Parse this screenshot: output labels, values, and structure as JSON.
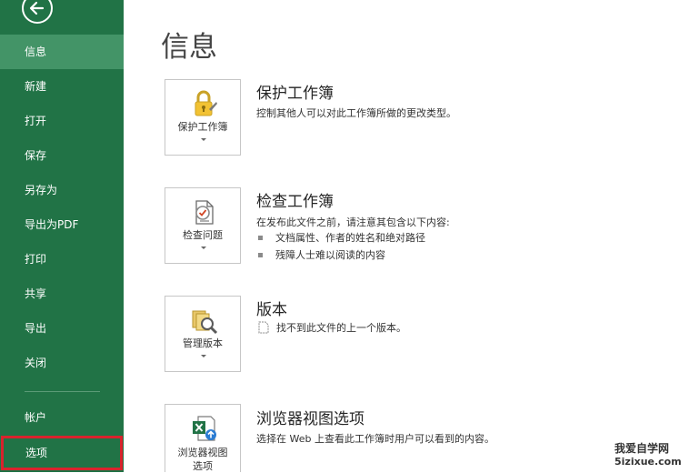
{
  "sidebar": {
    "items": [
      {
        "label": "信息"
      },
      {
        "label": "新建"
      },
      {
        "label": "打开"
      },
      {
        "label": "保存"
      },
      {
        "label": "另存为"
      },
      {
        "label": "导出为PDF"
      },
      {
        "label": "打印"
      },
      {
        "label": "共享"
      },
      {
        "label": "导出"
      },
      {
        "label": "关闭"
      },
      {
        "label": "帐户"
      },
      {
        "label": "选项"
      }
    ],
    "active_index": 0,
    "highlighted_index": 11
  },
  "main": {
    "title": "信息",
    "sections": [
      {
        "button_label": "保护工作簿",
        "title": "保护工作簿",
        "description": "控制其他人可以对此工作簿所做的更改类型。"
      },
      {
        "button_label": "检查问题",
        "title": "检查工作簿",
        "description": "在发布此文件之前，请注意其包含以下内容:",
        "bullets": [
          "文档属性、作者的姓名和绝对路径",
          "残障人士难以阅读的内容"
        ]
      },
      {
        "button_label": "管理版本",
        "title": "版本",
        "note": "找不到此文件的上一个版本。"
      },
      {
        "button_label_line1": "浏览器视图",
        "button_label_line2": "选项",
        "title": "浏览器视图选项",
        "description": "选择在 Web 上查看此工作簿时用户可以看到的内容。"
      }
    ]
  },
  "watermark": {
    "line1": "我爱自学网",
    "line2": "5izixue.com"
  },
  "colors": {
    "sidebar": "#217346",
    "active_item": "#439467",
    "highlight_border": "#d9232d"
  },
  "icons": [
    "back-arrow-icon",
    "lock-icon",
    "inspect-icon",
    "versions-icon",
    "excel-web-icon",
    "document-icon"
  ]
}
